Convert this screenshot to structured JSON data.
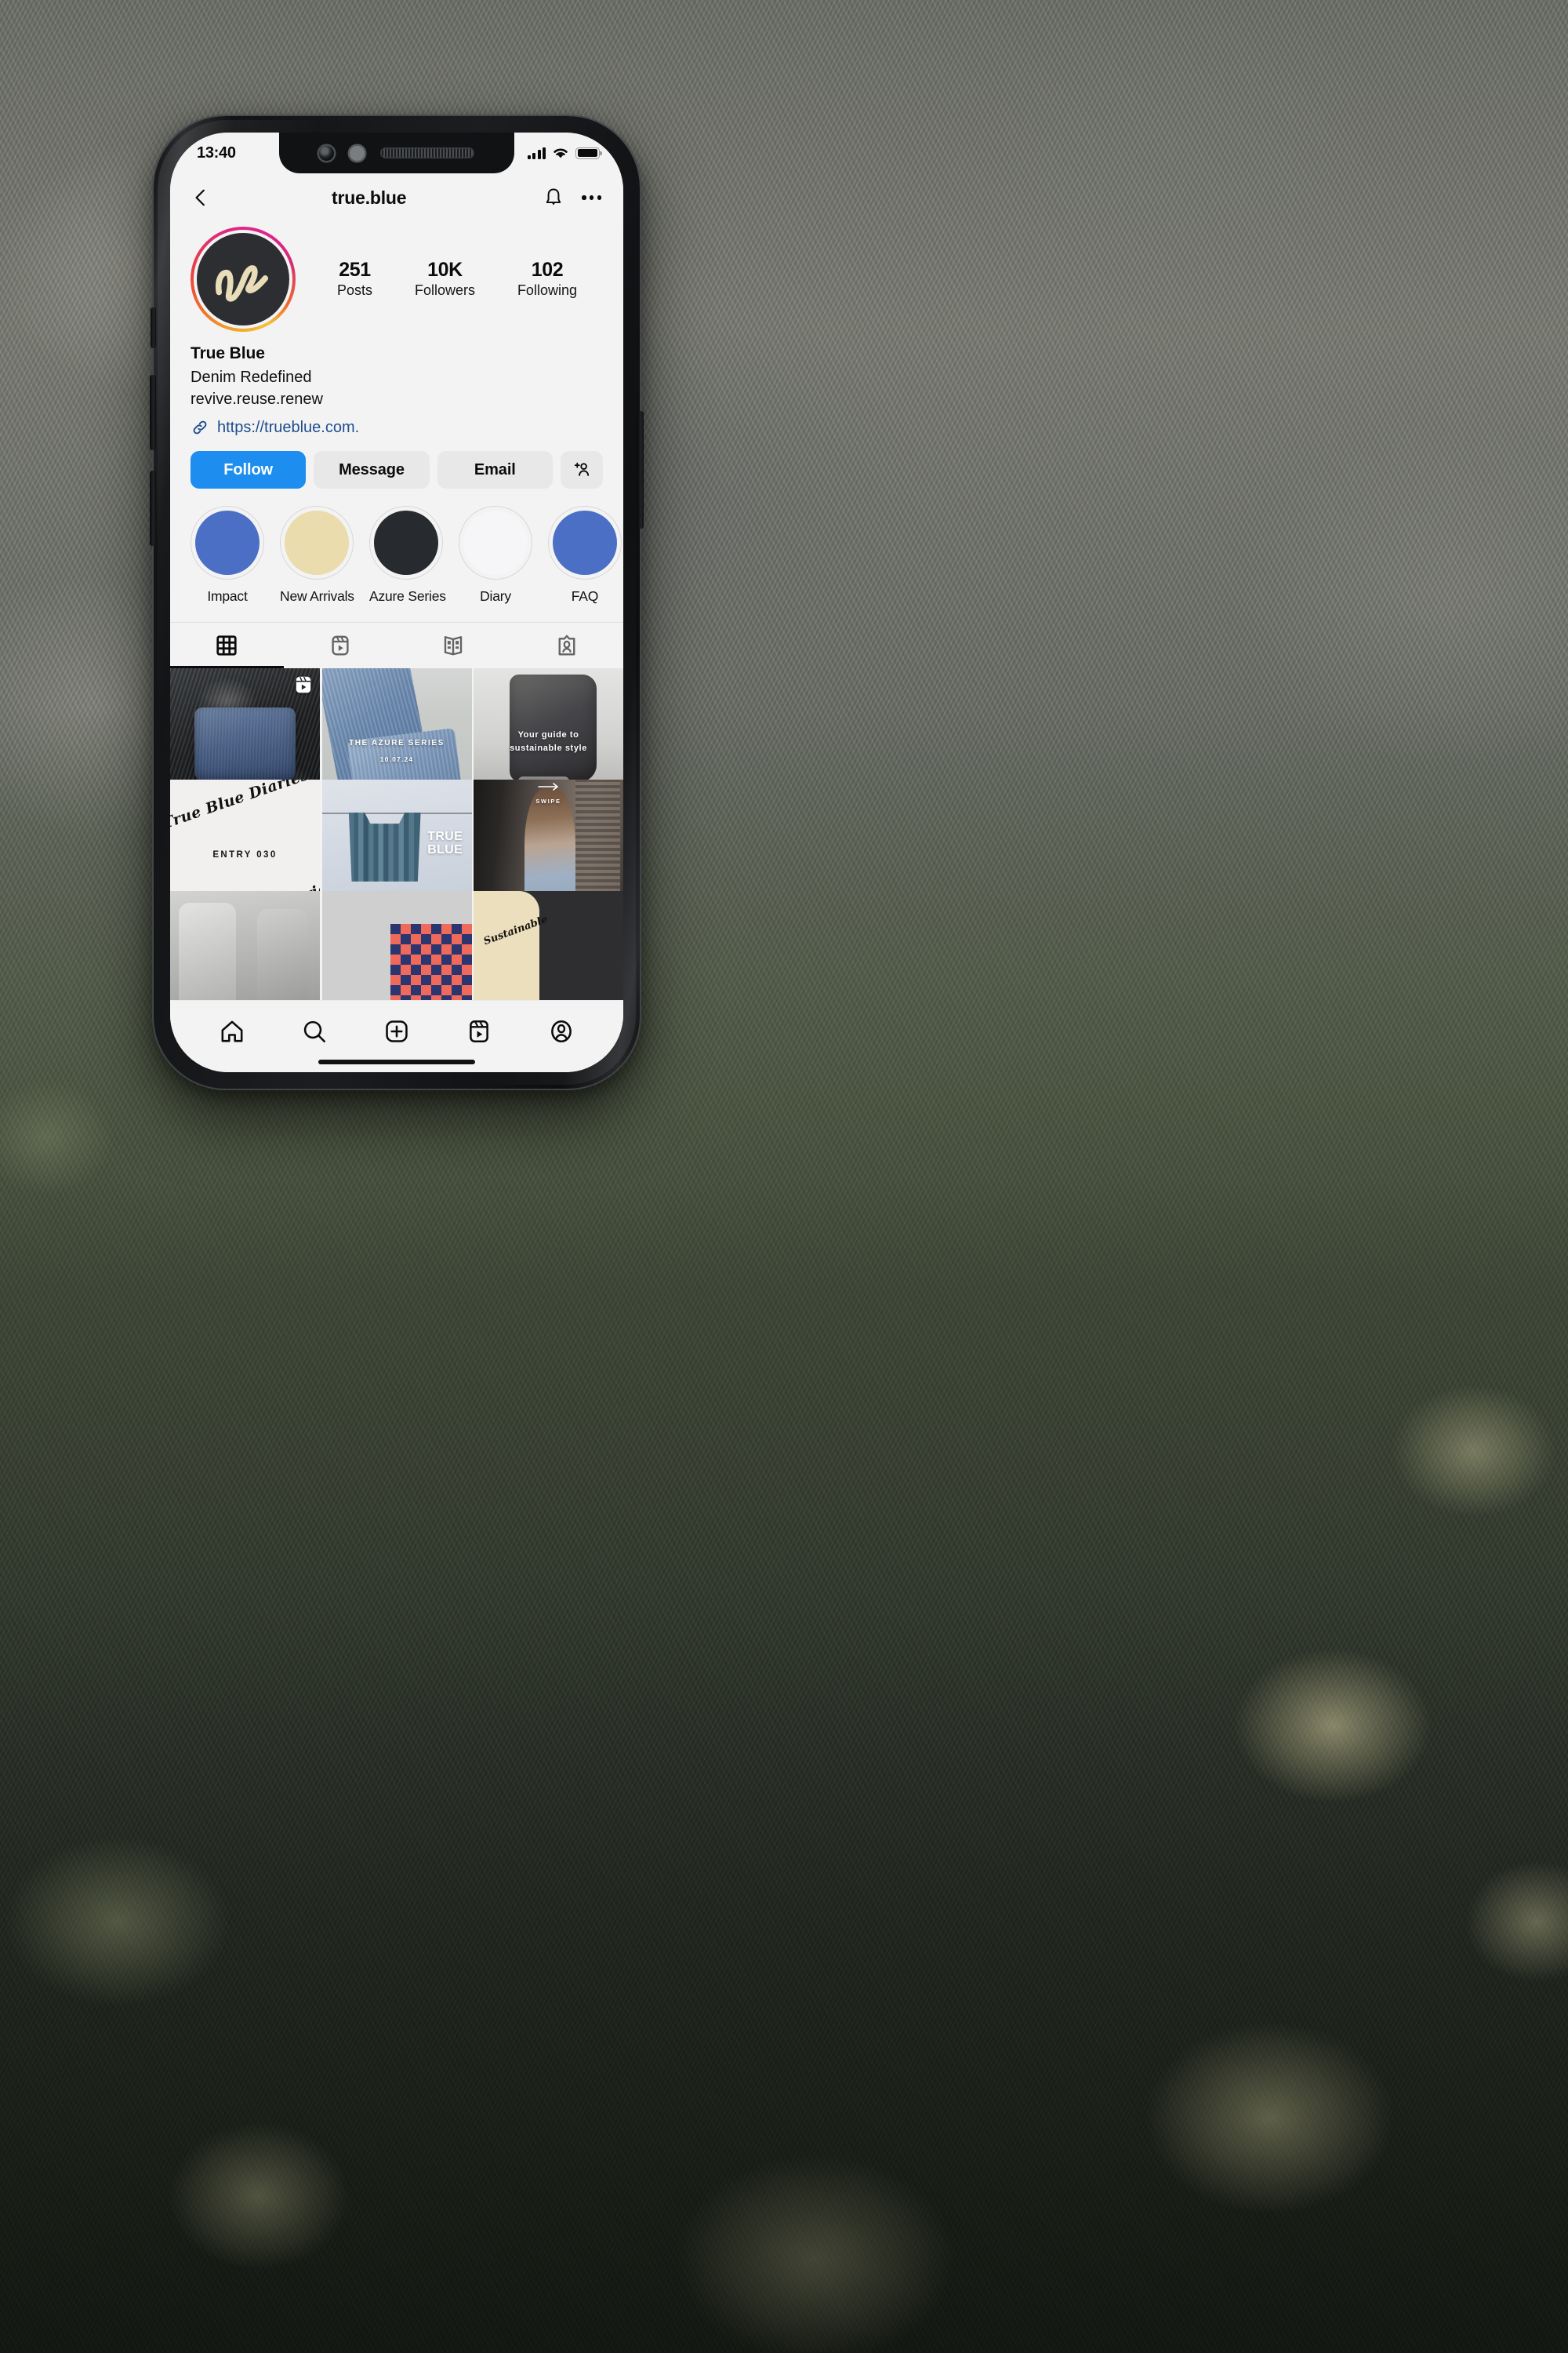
{
  "status_bar": {
    "time": "13:40",
    "signal_icon": "cellular-signal-icon",
    "wifi_icon": "wifi-icon",
    "battery_icon": "battery-full-icon"
  },
  "topbar": {
    "back_icon": "back-chevron-icon",
    "username": "true.blue",
    "notify_icon": "bell-icon",
    "more_icon": "more-options-icon"
  },
  "profile": {
    "avatar_icon": "profile-avatar-logo",
    "avatar_has_story_ring": true,
    "ring_colors": [
      "#f5c13d",
      "#ef6f2a",
      "#e9443f",
      "#dd2a7b"
    ],
    "avatar_bg": "#2c2e31",
    "stats": [
      {
        "value": "251",
        "label": "Posts"
      },
      {
        "value": "10K",
        "label": "Followers"
      },
      {
        "value": "102",
        "label": "Following"
      }
    ],
    "name": "True Blue",
    "bio_lines": [
      "Denim Redefined",
      "revive.reuse.renew"
    ],
    "link_icon": "link-icon",
    "link_text": "https://trueblue.com.",
    "link_color": "#1d4d8f"
  },
  "actions": [
    {
      "label": "Follow",
      "style": "primary",
      "color": "#1d8ef0"
    },
    {
      "label": "Message",
      "style": "secondary"
    },
    {
      "label": "Email",
      "style": "secondary"
    },
    {
      "label": "",
      "style": "secondary",
      "icon": "add-person-icon"
    }
  ],
  "highlights": [
    {
      "label": "Impact",
      "color": "#4a6fc4"
    },
    {
      "label": "New Arrivals",
      "color": "#ebdcae"
    },
    {
      "label": "Azure Series",
      "color": "#272a2e"
    },
    {
      "label": "Diary",
      "color": "#f6f5f7"
    },
    {
      "label": "FAQ",
      "color": "#4a6fc4"
    }
  ],
  "tabs": [
    {
      "icon": "grid-icon",
      "active": true
    },
    {
      "icon": "reels-icon",
      "active": false
    },
    {
      "icon": "guides-icon",
      "active": false
    },
    {
      "icon": "tagged-icon",
      "active": false
    }
  ],
  "grid": [
    {
      "art": "art-jacket",
      "caption": "",
      "badge": "reels-icon"
    },
    {
      "art": "art-azure",
      "caption": "THE AZURE SERIES",
      "caption2": "10.07.24",
      "badge": ""
    },
    {
      "art": "art-guide",
      "caption": "Your guide to",
      "caption2": "sustainable style",
      "caption3": "SWIPE",
      "badge": ""
    },
    {
      "art": "art-diaries",
      "caption": "ENTRY 030",
      "script": "True Blue Diaries",
      "badge": ""
    },
    {
      "art": "art-corset",
      "caption": "",
      "brand_line1": "TRUE",
      "brand_line2": "BLUE",
      "badge": ""
    },
    {
      "art": "art-girl",
      "caption": "",
      "badge": ""
    },
    {
      "art": "art-gray1",
      "caption": "",
      "badge": ""
    },
    {
      "art": "art-check",
      "caption": "",
      "badge": ""
    },
    {
      "art": "art-sustain",
      "caption": "Sustainable",
      "badge": ""
    }
  ],
  "bottom_nav": [
    {
      "icon": "home-icon"
    },
    {
      "icon": "search-icon"
    },
    {
      "icon": "create-post-icon"
    },
    {
      "icon": "reels-icon"
    },
    {
      "icon": "profile-icon"
    }
  ]
}
